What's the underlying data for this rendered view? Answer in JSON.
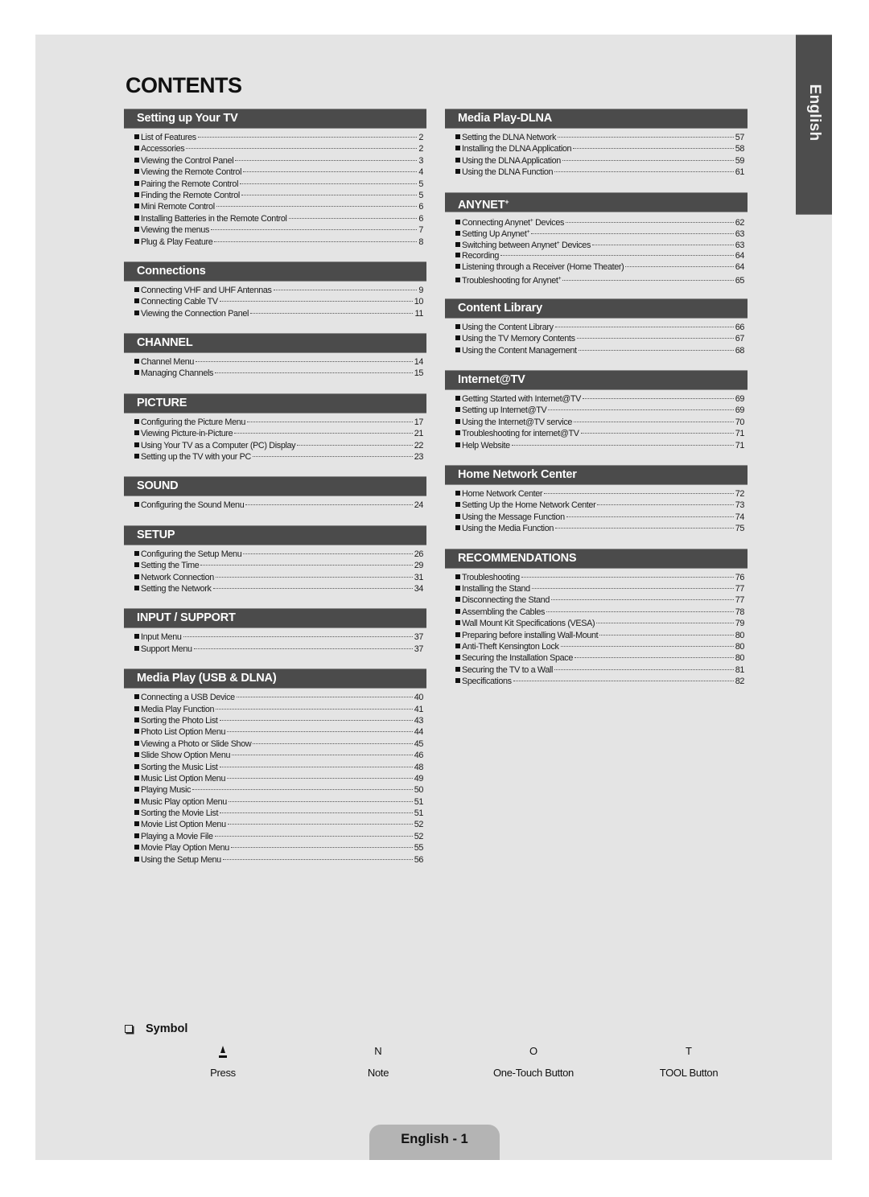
{
  "page_title": "CONTENTS",
  "language_tab": "English",
  "left_column": [
    {
      "header": "Setting up Your TV",
      "entries": [
        {
          "label": "List of Features",
          "page": "2"
        },
        {
          "label": "Accessories",
          "page": "2"
        },
        {
          "label": "Viewing the Control Panel",
          "page": "3"
        },
        {
          "label": "Viewing the Remote Control",
          "page": "4"
        },
        {
          "label": "Pairing the Remote Control",
          "page": "5"
        },
        {
          "label": "Finding the Remote Control",
          "page": "5"
        },
        {
          "label": "Mini Remote Control",
          "page": "6"
        },
        {
          "label": "Installing Batteries in the Remote Control",
          "page": "6"
        },
        {
          "label": "Viewing the menus",
          "page": "7"
        },
        {
          "label": "Plug & Play Feature",
          "page": "8"
        }
      ]
    },
    {
      "header": "Connections",
      "entries": [
        {
          "label": "Connecting VHF and UHF Antennas",
          "page": "9"
        },
        {
          "label": "Connecting Cable TV",
          "page": "10"
        },
        {
          "label": "Viewing the Connection Panel",
          "page": "11"
        }
      ]
    },
    {
      "header": "CHANNEL",
      "entries": [
        {
          "label": "Channel Menu",
          "page": "14"
        },
        {
          "label": "Managing Channels",
          "page": "15"
        }
      ]
    },
    {
      "header": "PICTURE",
      "entries": [
        {
          "label": "Configuring the Picture Menu",
          "page": "17"
        },
        {
          "label": "Viewing Picture-in-Picture",
          "page": "21"
        },
        {
          "label": "Using Your TV as a Computer (PC) Display",
          "page": "22"
        },
        {
          "label": "Setting up the TV with your PC",
          "page": "23"
        }
      ]
    },
    {
      "header": "SOUND",
      "entries": [
        {
          "label": "Configuring the Sound Menu",
          "page": "24"
        }
      ]
    },
    {
      "header": "SETUP",
      "entries": [
        {
          "label": "Configuring the Setup Menu",
          "page": "26"
        },
        {
          "label": "Setting the Time",
          "page": "29"
        },
        {
          "label": "Network Connection",
          "page": "31"
        },
        {
          "label": "Setting the Network",
          "page": "34"
        }
      ]
    },
    {
      "header": "INPUT / SUPPORT",
      "entries": [
        {
          "label": "Input Menu",
          "page": "37"
        },
        {
          "label": "Support Menu",
          "page": "37"
        }
      ]
    },
    {
      "header": "Media Play (USB & DLNA)",
      "entries": [
        {
          "label": "Connecting a USB Device",
          "page": "40"
        },
        {
          "label": "Media Play Function",
          "page": "41"
        },
        {
          "label": "Sorting the Photo List",
          "page": "43"
        },
        {
          "label": "Photo List Option Menu",
          "page": "44"
        },
        {
          "label": "Viewing a Photo or Slide Show",
          "page": "45"
        },
        {
          "label": "Slide Show Option Menu",
          "page": "46"
        },
        {
          "label": "Sorting the Music List",
          "page": "48"
        },
        {
          "label": "Music List Option Menu",
          "page": "49"
        },
        {
          "label": "Playing Music",
          "page": "50"
        },
        {
          "label": "Music Play option Menu",
          "page": "51"
        },
        {
          "label": "Sorting the Movie List",
          "page": "51"
        },
        {
          "label": "Movie List Option Menu",
          "page": "52"
        },
        {
          "label": "Playing a Movie File",
          "page": "52"
        },
        {
          "label": "Movie Play Option Menu",
          "page": "55"
        },
        {
          "label": "Using the Setup Menu",
          "page": "56"
        }
      ]
    }
  ],
  "right_column": [
    {
      "header": "Media Play-DLNA",
      "entries": [
        {
          "label": "Setting the DLNA Network",
          "page": "57"
        },
        {
          "label": "Installing the DLNA Application",
          "page": "58"
        },
        {
          "label": "Using the DLNA Application",
          "page": "59"
        },
        {
          "label": "Using the DLNA Function",
          "page": "61"
        }
      ]
    },
    {
      "header": "ANYNET",
      "header_sup": "+",
      "entries": [
        {
          "label": "Connecting Anynet",
          "sup": "+",
          "suffix": " Devices",
          "page": "62"
        },
        {
          "label": "Setting Up Anynet",
          "sup": "+",
          "suffix": "",
          "page": "63"
        },
        {
          "label": "Switching between Anynet",
          "sup": "+",
          "suffix": " Devices",
          "page": "63"
        },
        {
          "label": "Recording",
          "page": "64"
        },
        {
          "label": "Listening through a Receiver (Home Theater)",
          "page": "64"
        },
        {
          "label": "Troubleshooting for Anynet",
          "sup": "+",
          "suffix": "",
          "page": "65"
        }
      ]
    },
    {
      "header": "Content Library",
      "entries": [
        {
          "label": "Using the Content Library",
          "page": "66"
        },
        {
          "label": "Using the TV Memory Contents",
          "page": "67"
        },
        {
          "label": "Using the Content Management",
          "page": "68"
        }
      ]
    },
    {
      "header": "Internet@TV",
      "entries": [
        {
          "label": "Getting Started with Internet@TV",
          "page": "69"
        },
        {
          "label": "Setting up Internet@TV",
          "page": "69"
        },
        {
          "label": "Using the Internet@TV service",
          "page": "70"
        },
        {
          "label": "Troubleshooting for internet@TV",
          "page": "71"
        },
        {
          "label": "Help Website",
          "page": "71"
        }
      ]
    },
    {
      "header": "Home Network Center",
      "entries": [
        {
          "label": "Home Network Center",
          "page": "72"
        },
        {
          "label": "Setting Up the Home Network Center",
          "page": "73"
        },
        {
          "label": "Using the Message Function",
          "page": "74"
        },
        {
          "label": "Using the Media Function",
          "page": "75"
        }
      ]
    },
    {
      "header": "RECOMMENDATIONS",
      "entries": [
        {
          "label": "Troubleshooting",
          "page": "76"
        },
        {
          "label": "Installing the Stand",
          "page": "77"
        },
        {
          "label": "Disconnecting the Stand",
          "page": "77"
        },
        {
          "label": "Assembling the Cables",
          "page": "78"
        },
        {
          "label": "Wall Mount Kit Specifications (VESA)",
          "page": "79"
        },
        {
          "label": "Preparing before installing Wall-Mount",
          "page": "80"
        },
        {
          "label": "Anti-Theft Kensington Lock",
          "page": "80"
        },
        {
          "label": "Securing the Installation Space",
          "page": "80"
        },
        {
          "label": "Securing the TV to a Wall",
          "page": "81"
        },
        {
          "label": "Specifications",
          "page": "82"
        }
      ]
    }
  ],
  "symbols": {
    "heading": "Symbol",
    "items": [
      {
        "icon": "press-icon",
        "glyph": "",
        "label": "Press"
      },
      {
        "icon": "note-icon",
        "glyph": "N",
        "label": "Note"
      },
      {
        "icon": "one-touch-icon",
        "glyph": "O",
        "label": "One-Touch Button"
      },
      {
        "icon": "tool-icon",
        "glyph": "T",
        "label": "TOOL Button"
      }
    ]
  },
  "footer": {
    "page_label": "English - 1"
  }
}
